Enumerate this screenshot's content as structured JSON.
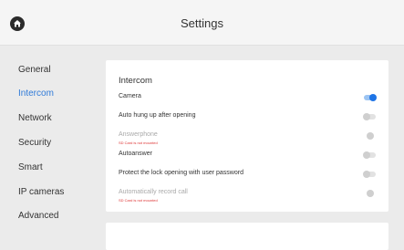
{
  "header": {
    "title": "Settings",
    "home_icon": "home-icon"
  },
  "sidebar": {
    "items": [
      {
        "label": "General",
        "active": false
      },
      {
        "label": "Intercom",
        "active": true
      },
      {
        "label": "Network",
        "active": false
      },
      {
        "label": "Security",
        "active": false
      },
      {
        "label": "Smart",
        "active": false
      },
      {
        "label": "IP cameras",
        "active": false
      },
      {
        "label": "Advanced",
        "active": false
      }
    ]
  },
  "intercom": {
    "title": "Intercom",
    "rows": [
      {
        "label": "Camera",
        "state": "on",
        "disabled": false
      },
      {
        "label": "Auto hung up after opening",
        "state": "off",
        "disabled": false
      },
      {
        "label": "Answerphone",
        "warning": "SD Card is not mounted",
        "state": "off",
        "disabled": true
      },
      {
        "label": "Autoanswer",
        "state": "off",
        "disabled": false
      },
      {
        "label": "Protect the lock opening with user password",
        "state": "off",
        "disabled": false
      },
      {
        "label": "Automatically record call",
        "warning": "SD Card is not mounted",
        "state": "off",
        "disabled": true
      }
    ]
  },
  "colors": {
    "accent": "#2f7ad8",
    "toggle_on": "#1e74e6",
    "warning": "#dd3333",
    "background": "#ebebeb"
  }
}
